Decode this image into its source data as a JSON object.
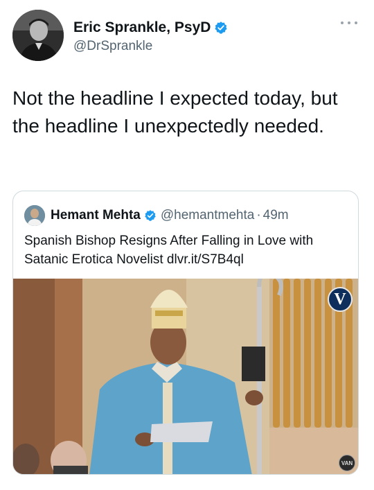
{
  "author": {
    "name": "Eric Sprankle, PsyD",
    "handle": "@DrSprankle",
    "avatar_icon": "avatar-photo-icon",
    "verified_icon": "verified-badge-icon"
  },
  "tweet": {
    "text": "Not the headline I expected today, but the headline I unexpectedly needed."
  },
  "more_icon": "more-options-icon",
  "quoted": {
    "name": "Hemant Mehta",
    "handle": "@hemantmehta",
    "separator": "·",
    "time": "49m",
    "text": "Spanish Bishop Resigns After Falling in Love with Satanic Erotica Novelist dlvr.it/S7B4ql",
    "media": {
      "description_icon": "news-photo-icon",
      "badge_letter": "V",
      "watermark": "VAN"
    }
  },
  "colors": {
    "verified_blue": "#1d9bf0",
    "secondary_text": "#536471",
    "border": "#cfd9de"
  }
}
